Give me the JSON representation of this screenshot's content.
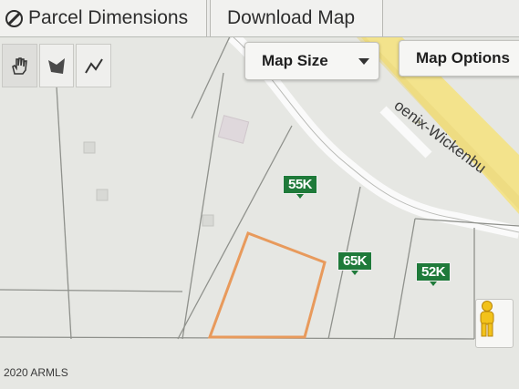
{
  "toolbar": {
    "parcel_dimensions": "Parcel Dimensions",
    "download_map": "Download Map"
  },
  "controls": {
    "map_size": "Map Size",
    "map_options": "Map Options"
  },
  "map": {
    "road_label": "oenix-Wickenbu",
    "prices": [
      "55K",
      "65K",
      "52K"
    ],
    "copyright": "2020 ARMLS"
  },
  "colors": {
    "road": "#f3e38c",
    "price_badge": "#1f7a3a",
    "selected_parcel": "#e89a5c"
  },
  "icons": [
    "ban-icon",
    "hand-pan-icon",
    "polygon-icon",
    "polyline-icon",
    "pegman-icon",
    "caret-down-icon"
  ]
}
